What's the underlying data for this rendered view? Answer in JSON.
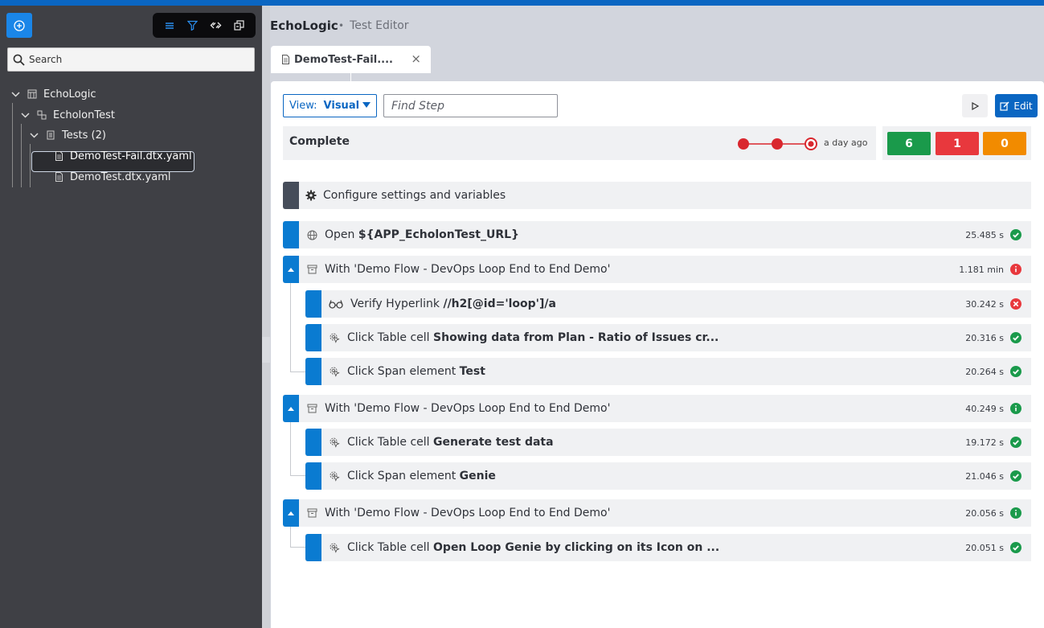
{
  "app": {
    "title": "EchoLogic",
    "separator": "•",
    "subtitle": "Test Editor"
  },
  "sidebar": {
    "search_placeholder": "Search",
    "tree": {
      "root": "EchoLogic",
      "project": "EcholonTest",
      "folder": "Tests (2)",
      "files": [
        "DemoTest-Fail.dtx.yaml",
        "DemoTest.dtx.yaml"
      ]
    }
  },
  "tab": {
    "label": "DemoTest-Fail....",
    "close": "×"
  },
  "toolbar": {
    "view_label": "View:",
    "view_value": "Visual",
    "find_placeholder": "Find Step",
    "edit_label": "Edit"
  },
  "status": {
    "text": "Complete",
    "ago": "a day ago",
    "passed": "6",
    "failed": "1",
    "skipped": "0"
  },
  "colors": {
    "accent": "#0a66c2",
    "pass": "#1a9a4b",
    "fail": "#e8383d",
    "warn": "#f28b00"
  },
  "config": {
    "label": "Configure settings and variables",
    "icon": "gear-icon"
  },
  "steps": [
    {
      "prefix": "Open ",
      "bold": "${APP_EcholonTest_URL}",
      "time": "25.485 s",
      "status": "pass",
      "icon": "globe-icon"
    },
    {
      "prefix": "With 'Demo Flow - DevOps Loop End to End Demo'",
      "bold": "",
      "time": "1.181 min",
      "status": "fail-info",
      "icon": "archive-icon"
    },
    {
      "prefix": "Verify Hyperlink ",
      "bold": "//h2[@id='loop']/a",
      "time": "30.242 s",
      "status": "fail",
      "icon": "glasses-icon"
    },
    {
      "prefix": "Click Table cell ",
      "bold": "Showing data from Plan - Ratio of Issues cr...",
      "time": "20.316 s",
      "status": "pass",
      "icon": "click-icon"
    },
    {
      "prefix": "Click Span element ",
      "bold": "Test",
      "time": "20.264 s",
      "status": "pass",
      "icon": "click-icon"
    },
    {
      "prefix": "With 'Demo Flow - DevOps Loop End to End Demo'",
      "bold": "",
      "time": "40.249 s",
      "status": "pass-info",
      "icon": "archive-icon"
    },
    {
      "prefix": "Click Table cell ",
      "bold": "Generate test data",
      "time": "19.172 s",
      "status": "pass",
      "icon": "click-icon"
    },
    {
      "prefix": "Click Span element ",
      "bold": "Genie",
      "time": "21.046 s",
      "status": "pass",
      "icon": "click-icon"
    },
    {
      "prefix": "With 'Demo Flow - DevOps Loop End to End Demo'",
      "bold": "",
      "time": "20.056 s",
      "status": "pass-info",
      "icon": "archive-icon"
    },
    {
      "prefix": "Click Table cell ",
      "bold": "Open Loop Genie by clicking on its Icon on ...",
      "time": "20.051 s",
      "status": "pass",
      "icon": "click-icon"
    }
  ]
}
